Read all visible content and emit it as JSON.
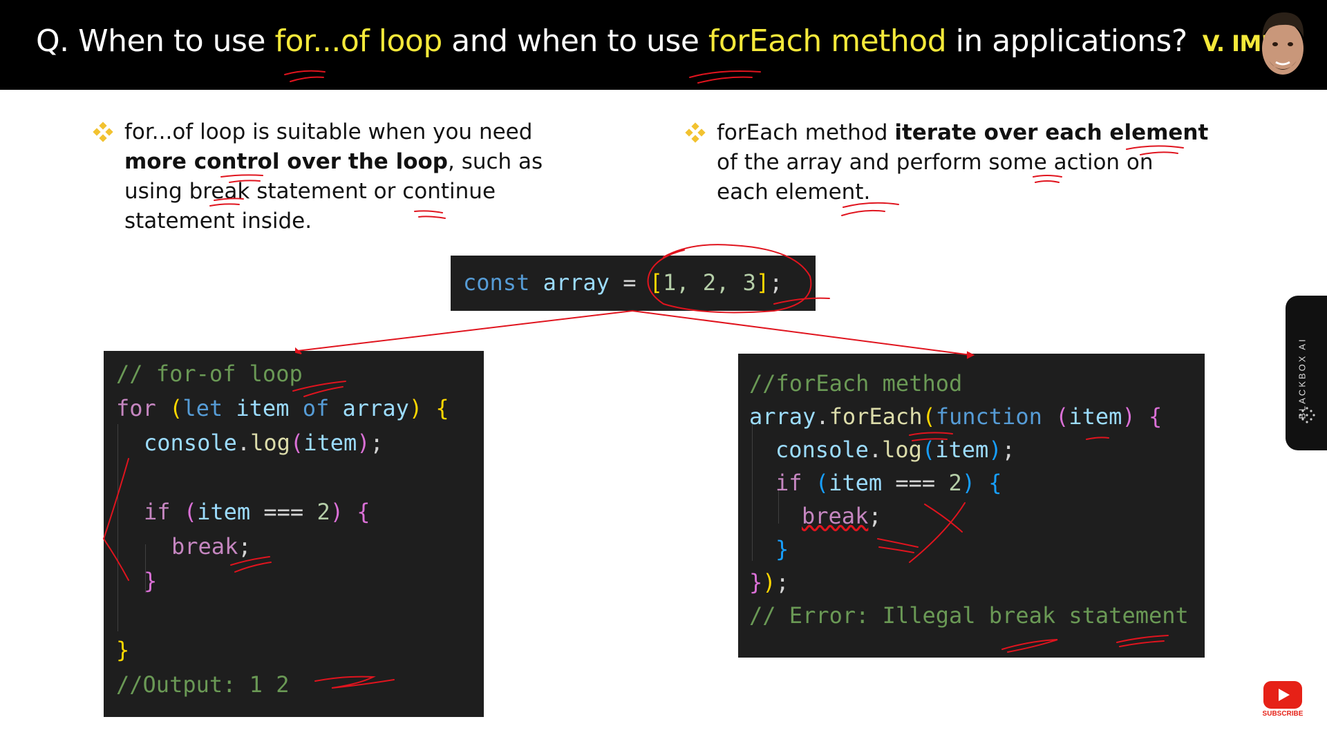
{
  "header": {
    "q_prefix": "Q. When to use ",
    "term1": "for...of loop",
    "q_mid": " and when to use ",
    "term2": "forEach method",
    "q_suffix": " in applications?",
    "tag": "V. IMP."
  },
  "left_bullet": {
    "l1": "for...of loop is suitable when you need",
    "l2_bold": "more control over the loop",
    "l2_rest": ", such as",
    "l3": "using break statement or continue",
    "l4": "statement inside."
  },
  "right_bullet": {
    "l1_plain": "forEach method ",
    "l1_bold": "iterate over each element",
    "l2": "of the array and perform some action on",
    "l3": "each element."
  },
  "const_code": {
    "kw": "const",
    "name": "array",
    "eq": "=",
    "bracket_open": "[",
    "values": "1, 2, 3",
    "bracket_close": "]",
    "semi": ";"
  },
  "forof_code": {
    "comment": "// for-of loop",
    "for": "for",
    "let": "let",
    "item": "item",
    "of": "of",
    "array": "array",
    "console": "console",
    "log": "log",
    "if": "if",
    "eq": "===",
    "two": "2",
    "break": "break",
    "output": "//Output: 1 2"
  },
  "foreach_code": {
    "comment": "//forEach method",
    "array": "array",
    "forEach": "forEach",
    "function": "function",
    "item": "item",
    "console": "console",
    "log": "log",
    "if": "if",
    "eq": "===",
    "two": "2",
    "break": "break",
    "error": "// Error: Illegal break statement"
  },
  "sidebar": {
    "label": "BLACKBOX AI"
  },
  "youtube": {
    "label": "SUBSCRIBE"
  },
  "colors": {
    "highlight": "#f5e93a",
    "annotation": "#e0141e",
    "code_bg": "#1e1e1e"
  }
}
